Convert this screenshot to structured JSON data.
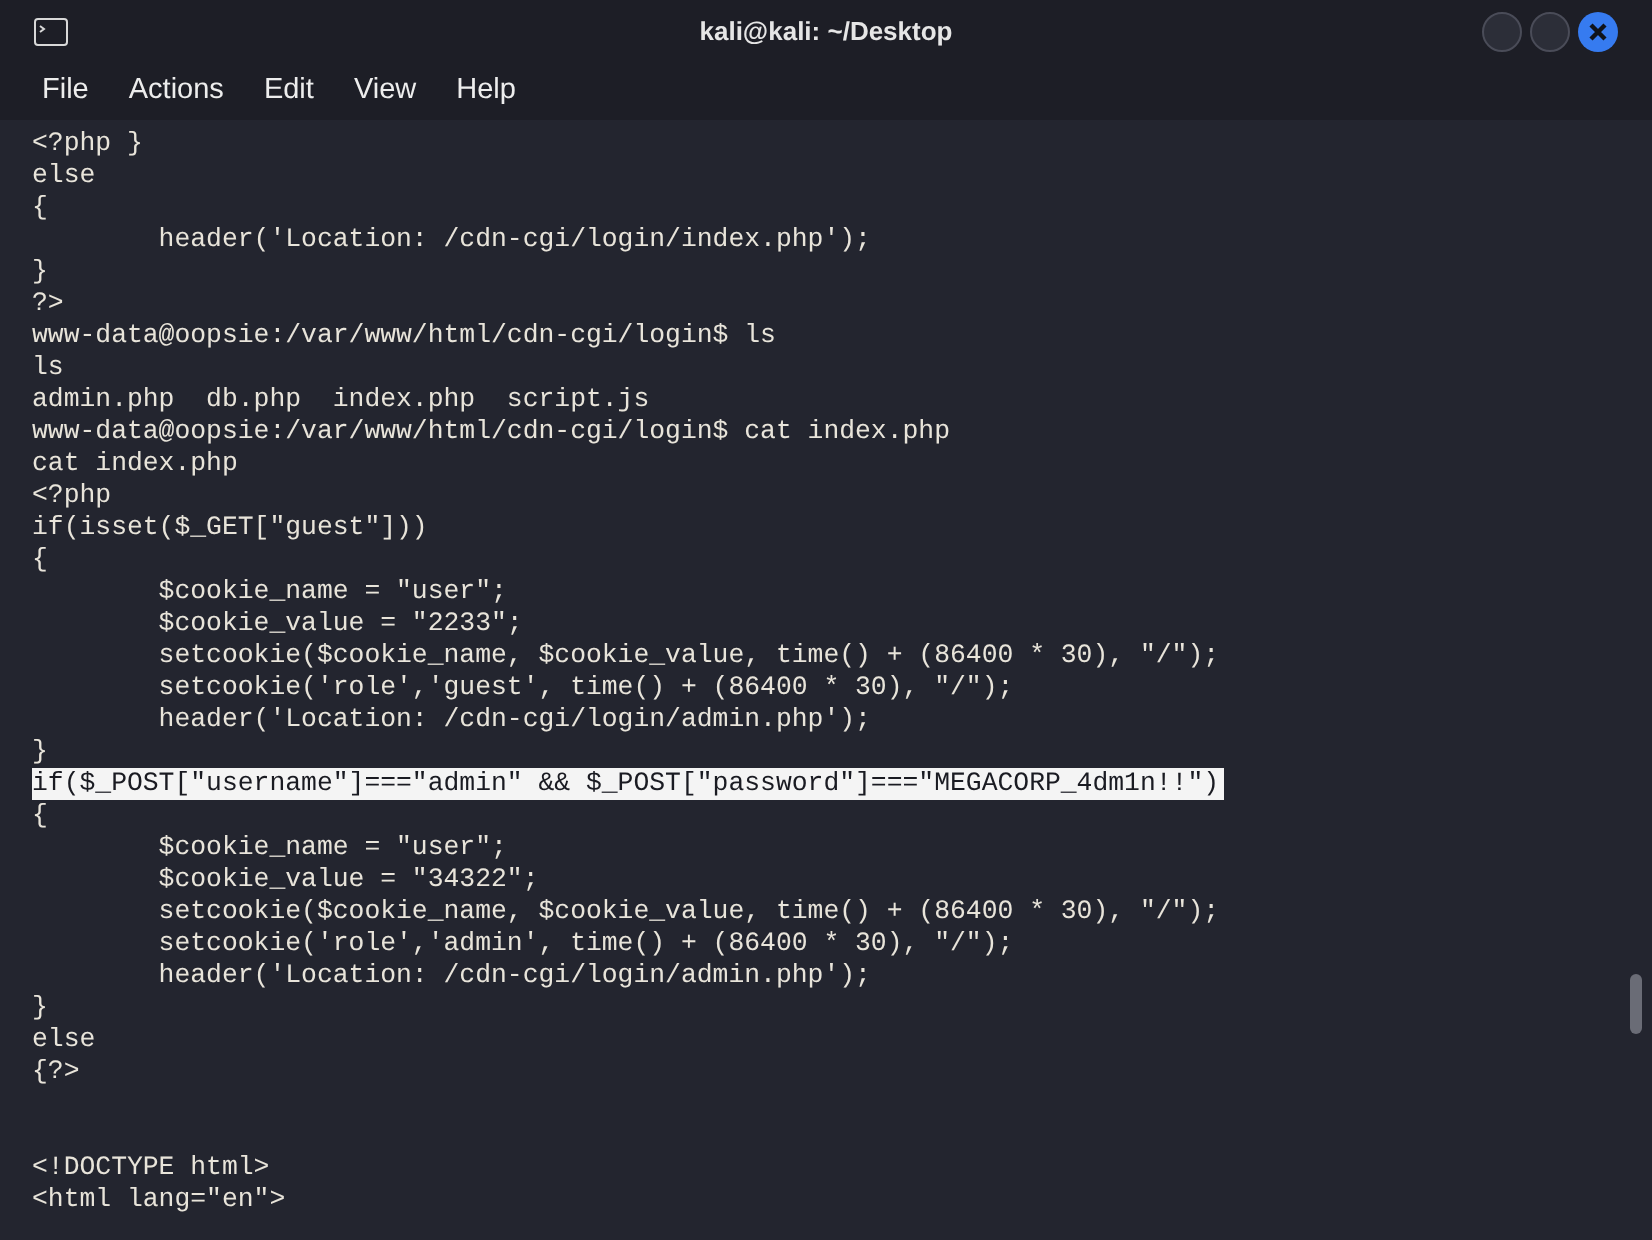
{
  "window": {
    "title": "kali@kali: ~/Desktop"
  },
  "menu": [
    "File",
    "Actions",
    "Edit",
    "View",
    "Help"
  ],
  "lines": [
    {
      "kind": "text",
      "text": "<?php }",
      "selected": false
    },
    {
      "kind": "text",
      "text": "else",
      "selected": false
    },
    {
      "kind": "text",
      "text": "{",
      "selected": false
    },
    {
      "kind": "text",
      "text": "        header('Location: /cdn-cgi/login/index.php');",
      "selected": false
    },
    {
      "kind": "text",
      "text": "}",
      "selected": false
    },
    {
      "kind": "text",
      "text": "?>",
      "selected": false
    },
    {
      "kind": "text",
      "text": "www-data@oopsie:/var/www/html/cdn-cgi/login$ ls",
      "selected": false
    },
    {
      "kind": "text",
      "text": "ls",
      "selected": false
    },
    {
      "kind": "text",
      "text": "admin.php  db.php  index.php  script.js",
      "selected": false
    },
    {
      "kind": "text",
      "text": "www-data@oopsie:/var/www/html/cdn-cgi/login$ cat index.php",
      "selected": false
    },
    {
      "kind": "text",
      "text": "cat index.php",
      "selected": false
    },
    {
      "kind": "text",
      "text": "<?php",
      "selected": false
    },
    {
      "kind": "text",
      "text": "if(isset($_GET[\"guest\"]))",
      "selected": false
    },
    {
      "kind": "text",
      "text": "{",
      "selected": false
    },
    {
      "kind": "text",
      "text": "        $cookie_name = \"user\";",
      "selected": false
    },
    {
      "kind": "text",
      "text": "        $cookie_value = \"2233\";",
      "selected": false
    },
    {
      "kind": "text",
      "text": "        setcookie($cookie_name, $cookie_value, time() + (86400 * 30), \"/\");",
      "selected": false
    },
    {
      "kind": "text",
      "text": "        setcookie('role','guest', time() + (86400 * 30), \"/\");",
      "selected": false
    },
    {
      "kind": "text",
      "text": "        header('Location: /cdn-cgi/login/admin.php');",
      "selected": false
    },
    {
      "kind": "text",
      "text": "}",
      "selected": false
    },
    {
      "kind": "text",
      "text": "if($_POST[\"username\"]===\"admin\" && $_POST[\"password\"]===\"MEGACORP_4dm1n!!\")",
      "selected": true
    },
    {
      "kind": "text",
      "text": "{",
      "selected": false
    },
    {
      "kind": "text",
      "text": "        $cookie_name = \"user\";",
      "selected": false
    },
    {
      "kind": "text",
      "text": "        $cookie_value = \"34322\";",
      "selected": false
    },
    {
      "kind": "text",
      "text": "        setcookie($cookie_name, $cookie_value, time() + (86400 * 30), \"/\");",
      "selected": false
    },
    {
      "kind": "text",
      "text": "        setcookie('role','admin', time() + (86400 * 30), \"/\");",
      "selected": false
    },
    {
      "kind": "text",
      "text": "        header('Location: /cdn-cgi/login/admin.php');",
      "selected": false
    },
    {
      "kind": "text",
      "text": "}",
      "selected": false
    },
    {
      "kind": "text",
      "text": "else",
      "selected": false
    },
    {
      "kind": "text",
      "text": "{?>",
      "selected": false
    },
    {
      "kind": "blank"
    },
    {
      "kind": "blank"
    },
    {
      "kind": "text",
      "text": "<!DOCTYPE html>",
      "selected": false
    },
    {
      "kind": "text",
      "text": "<html lang=\"en\">",
      "selected": false
    }
  ]
}
